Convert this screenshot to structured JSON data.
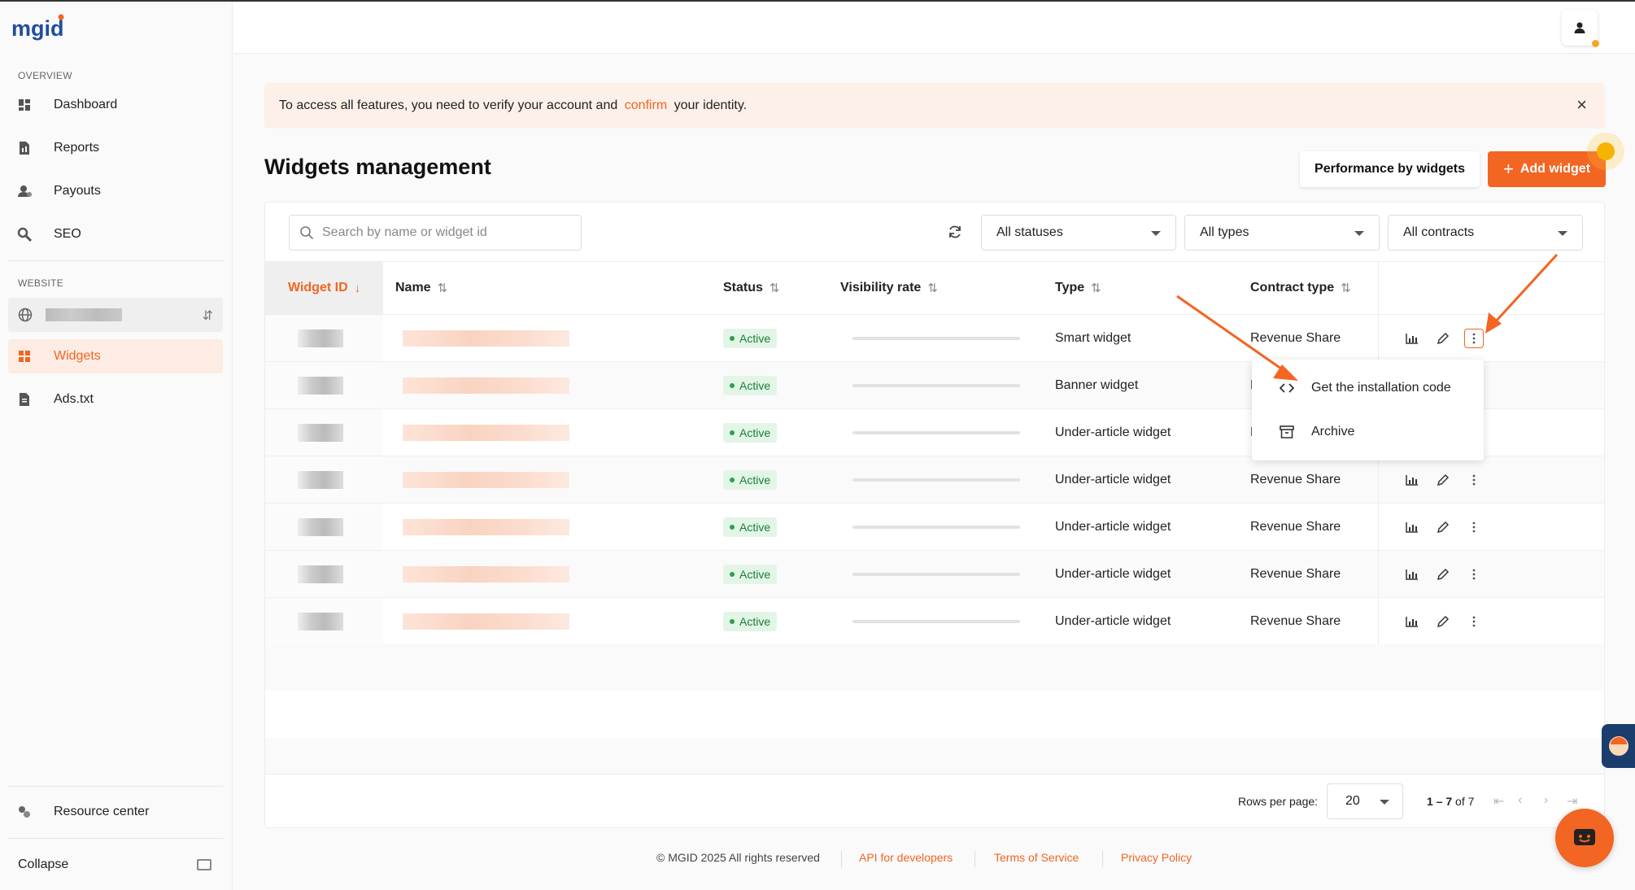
{
  "app": {
    "logo_text": "mgid"
  },
  "sidebar": {
    "overview_label": "OVERVIEW",
    "website_label": "WEBSITE",
    "items": [
      {
        "label": "Dashboard",
        "icon": "dashboard-icon"
      },
      {
        "label": "Reports",
        "icon": "reports-icon"
      },
      {
        "label": "Payouts",
        "icon": "payouts-icon"
      },
      {
        "label": "SEO",
        "icon": "seo-icon"
      }
    ],
    "website_items": [
      {
        "label": "Widgets",
        "icon": "widgets-icon",
        "active": true
      },
      {
        "label": "Ads.txt",
        "icon": "ads-txt-icon"
      }
    ],
    "resource_center": "Resource center",
    "collapse": "Collapse"
  },
  "banner": {
    "text_before": "To access all features, you need to verify your account and ",
    "link": "confirm",
    "text_after": " your identity."
  },
  "page": {
    "title": "Widgets management",
    "perf_button": "Performance by widgets",
    "add_button": "Add widget"
  },
  "filters": {
    "search_placeholder": "Search by name or widget id",
    "status": "All statuses",
    "types": "All types",
    "contracts": "All contracts"
  },
  "table": {
    "columns": [
      "Widget ID",
      "Name",
      "Status",
      "Visibility rate",
      "Type",
      "Contract type"
    ],
    "rows": [
      {
        "status": "Active",
        "type": "Smart widget",
        "contract": "Revenue Share"
      },
      {
        "status": "Active",
        "type": "Banner widget",
        "contract": "Revenue Share"
      },
      {
        "status": "Active",
        "type": "Under-article widget",
        "contract": "Revenue Share"
      },
      {
        "status": "Active",
        "type": "Under-article widget",
        "contract": "Revenue Share"
      },
      {
        "status": "Active",
        "type": "Under-article widget",
        "contract": "Revenue Share"
      },
      {
        "status": "Active",
        "type": "Under-article widget",
        "contract": "Revenue Share"
      },
      {
        "status": "Active",
        "type": "Under-article widget",
        "contract": "Revenue Share"
      }
    ]
  },
  "menu": {
    "items": [
      {
        "label": "Get the installation code",
        "icon": "code-icon"
      },
      {
        "label": "Archive",
        "icon": "archive-icon"
      }
    ]
  },
  "pagination": {
    "rows_per_page_label": "Rows per page:",
    "rows_per_page": "20",
    "range_bold": "1 – 7",
    "range_rest": " of 7"
  },
  "footer": {
    "copyright": "© MGID 2025 All rights reserved",
    "api": "API for developers",
    "terms": "Terms of Service",
    "privacy": "Privacy Policy"
  },
  "colors": {
    "accent": "#f26522",
    "active_badge": "#e3f5e7"
  }
}
